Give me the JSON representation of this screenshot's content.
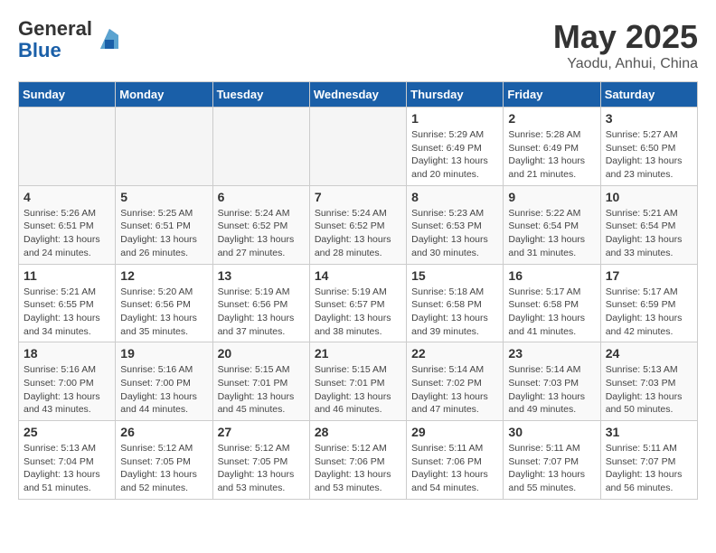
{
  "logo": {
    "general": "General",
    "blue": "Blue"
  },
  "title": "May 2025",
  "subtitle": "Yaodu, Anhui, China",
  "days": [
    "Sunday",
    "Monday",
    "Tuesday",
    "Wednesday",
    "Thursday",
    "Friday",
    "Saturday"
  ],
  "weeks": [
    [
      {
        "day": "",
        "detail": ""
      },
      {
        "day": "",
        "detail": ""
      },
      {
        "day": "",
        "detail": ""
      },
      {
        "day": "",
        "detail": ""
      },
      {
        "day": "1",
        "detail": "Sunrise: 5:29 AM\nSunset: 6:49 PM\nDaylight: 13 hours\nand 20 minutes."
      },
      {
        "day": "2",
        "detail": "Sunrise: 5:28 AM\nSunset: 6:49 PM\nDaylight: 13 hours\nand 21 minutes."
      },
      {
        "day": "3",
        "detail": "Sunrise: 5:27 AM\nSunset: 6:50 PM\nDaylight: 13 hours\nand 23 minutes."
      }
    ],
    [
      {
        "day": "4",
        "detail": "Sunrise: 5:26 AM\nSunset: 6:51 PM\nDaylight: 13 hours\nand 24 minutes."
      },
      {
        "day": "5",
        "detail": "Sunrise: 5:25 AM\nSunset: 6:51 PM\nDaylight: 13 hours\nand 26 minutes."
      },
      {
        "day": "6",
        "detail": "Sunrise: 5:24 AM\nSunset: 6:52 PM\nDaylight: 13 hours\nand 27 minutes."
      },
      {
        "day": "7",
        "detail": "Sunrise: 5:24 AM\nSunset: 6:52 PM\nDaylight: 13 hours\nand 28 minutes."
      },
      {
        "day": "8",
        "detail": "Sunrise: 5:23 AM\nSunset: 6:53 PM\nDaylight: 13 hours\nand 30 minutes."
      },
      {
        "day": "9",
        "detail": "Sunrise: 5:22 AM\nSunset: 6:54 PM\nDaylight: 13 hours\nand 31 minutes."
      },
      {
        "day": "10",
        "detail": "Sunrise: 5:21 AM\nSunset: 6:54 PM\nDaylight: 13 hours\nand 33 minutes."
      }
    ],
    [
      {
        "day": "11",
        "detail": "Sunrise: 5:21 AM\nSunset: 6:55 PM\nDaylight: 13 hours\nand 34 minutes."
      },
      {
        "day": "12",
        "detail": "Sunrise: 5:20 AM\nSunset: 6:56 PM\nDaylight: 13 hours\nand 35 minutes."
      },
      {
        "day": "13",
        "detail": "Sunrise: 5:19 AM\nSunset: 6:56 PM\nDaylight: 13 hours\nand 37 minutes."
      },
      {
        "day": "14",
        "detail": "Sunrise: 5:19 AM\nSunset: 6:57 PM\nDaylight: 13 hours\nand 38 minutes."
      },
      {
        "day": "15",
        "detail": "Sunrise: 5:18 AM\nSunset: 6:58 PM\nDaylight: 13 hours\nand 39 minutes."
      },
      {
        "day": "16",
        "detail": "Sunrise: 5:17 AM\nSunset: 6:58 PM\nDaylight: 13 hours\nand 41 minutes."
      },
      {
        "day": "17",
        "detail": "Sunrise: 5:17 AM\nSunset: 6:59 PM\nDaylight: 13 hours\nand 42 minutes."
      }
    ],
    [
      {
        "day": "18",
        "detail": "Sunrise: 5:16 AM\nSunset: 7:00 PM\nDaylight: 13 hours\nand 43 minutes."
      },
      {
        "day": "19",
        "detail": "Sunrise: 5:16 AM\nSunset: 7:00 PM\nDaylight: 13 hours\nand 44 minutes."
      },
      {
        "day": "20",
        "detail": "Sunrise: 5:15 AM\nSunset: 7:01 PM\nDaylight: 13 hours\nand 45 minutes."
      },
      {
        "day": "21",
        "detail": "Sunrise: 5:15 AM\nSunset: 7:01 PM\nDaylight: 13 hours\nand 46 minutes."
      },
      {
        "day": "22",
        "detail": "Sunrise: 5:14 AM\nSunset: 7:02 PM\nDaylight: 13 hours\nand 47 minutes."
      },
      {
        "day": "23",
        "detail": "Sunrise: 5:14 AM\nSunset: 7:03 PM\nDaylight: 13 hours\nand 49 minutes."
      },
      {
        "day": "24",
        "detail": "Sunrise: 5:13 AM\nSunset: 7:03 PM\nDaylight: 13 hours\nand 50 minutes."
      }
    ],
    [
      {
        "day": "25",
        "detail": "Sunrise: 5:13 AM\nSunset: 7:04 PM\nDaylight: 13 hours\nand 51 minutes."
      },
      {
        "day": "26",
        "detail": "Sunrise: 5:12 AM\nSunset: 7:05 PM\nDaylight: 13 hours\nand 52 minutes."
      },
      {
        "day": "27",
        "detail": "Sunrise: 5:12 AM\nSunset: 7:05 PM\nDaylight: 13 hours\nand 53 minutes."
      },
      {
        "day": "28",
        "detail": "Sunrise: 5:12 AM\nSunset: 7:06 PM\nDaylight: 13 hours\nand 53 minutes."
      },
      {
        "day": "29",
        "detail": "Sunrise: 5:11 AM\nSunset: 7:06 PM\nDaylight: 13 hours\nand 54 minutes."
      },
      {
        "day": "30",
        "detail": "Sunrise: 5:11 AM\nSunset: 7:07 PM\nDaylight: 13 hours\nand 55 minutes."
      },
      {
        "day": "31",
        "detail": "Sunrise: 5:11 AM\nSunset: 7:07 PM\nDaylight: 13 hours\nand 56 minutes."
      }
    ]
  ]
}
